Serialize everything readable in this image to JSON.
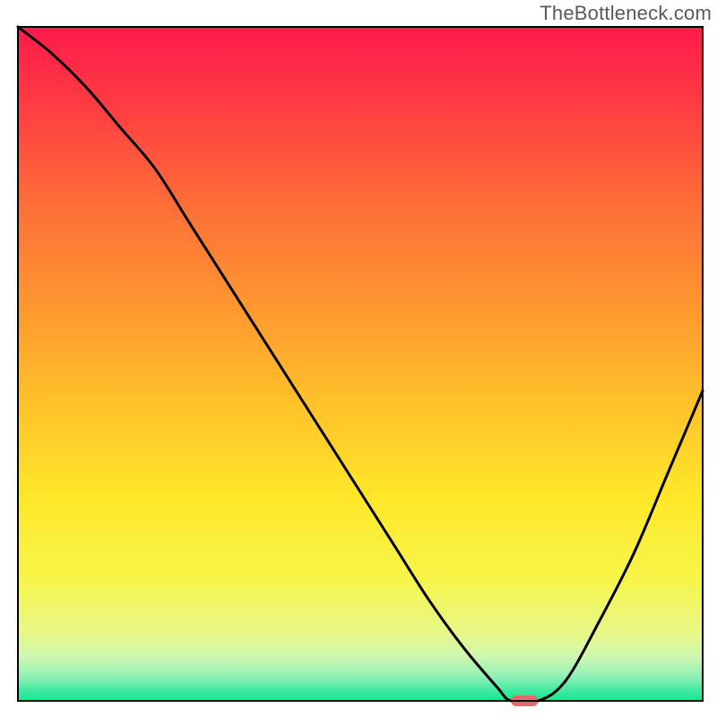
{
  "watermark": "TheBottleneck.com",
  "chart_data": {
    "type": "line",
    "title": "",
    "xlabel": "",
    "ylabel": "",
    "xlim": [
      0,
      100
    ],
    "ylim": [
      0,
      100
    ],
    "x": [
      0,
      5,
      10,
      15,
      20,
      25,
      30,
      35,
      40,
      45,
      50,
      55,
      60,
      65,
      70,
      72,
      76,
      80,
      85,
      90,
      95,
      100
    ],
    "values": [
      100,
      96,
      91,
      85,
      79,
      71,
      63,
      55,
      47,
      39,
      31,
      23,
      15,
      8,
      2,
      0,
      0,
      3,
      12,
      22,
      34,
      46
    ],
    "curve_color": "#000000",
    "marker": {
      "x": 74,
      "y": 0,
      "width_pct": 4,
      "height_pct": 1.6,
      "color": "#e16a6a"
    },
    "background_gradient_stops": [
      {
        "offset": 0.0,
        "color": "#ff1a4a"
      },
      {
        "offset": 0.12,
        "color": "#ff3d42"
      },
      {
        "offset": 0.25,
        "color": "#ff6a39"
      },
      {
        "offset": 0.4,
        "color": "#ff9330"
      },
      {
        "offset": 0.55,
        "color": "#ffbf2a"
      },
      {
        "offset": 0.7,
        "color": "#ffe82a"
      },
      {
        "offset": 0.82,
        "color": "#f7f54a"
      },
      {
        "offset": 0.9,
        "color": "#e8f889"
      },
      {
        "offset": 0.935,
        "color": "#cdf7b0"
      },
      {
        "offset": 0.965,
        "color": "#8ef0b6"
      },
      {
        "offset": 0.985,
        "color": "#3fe9a1"
      },
      {
        "offset": 1.0,
        "color": "#13e78f"
      }
    ],
    "frame": {
      "outer_margin_left": 20,
      "outer_margin_right": 16,
      "outer_margin_top": 30,
      "outer_margin_bottom": 18,
      "frame_stroke": "#000000",
      "frame_stroke_width": 2
    }
  }
}
